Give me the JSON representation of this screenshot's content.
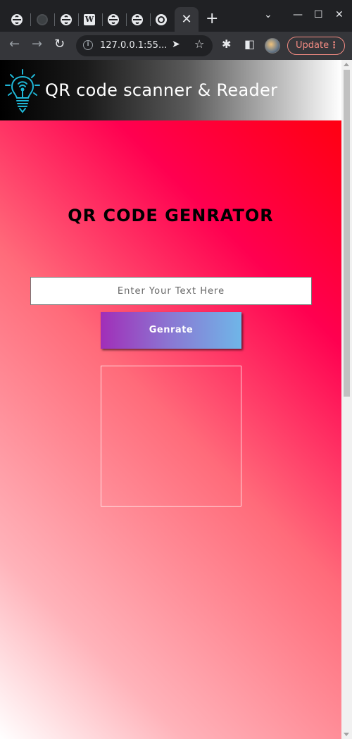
{
  "browser": {
    "tabs": [
      {
        "icon": "globe-icon"
      },
      {
        "icon": "github-icon"
      },
      {
        "icon": "globe-icon"
      },
      {
        "icon": "wikipedia-icon",
        "glyph": "W"
      },
      {
        "icon": "globe-icon"
      },
      {
        "icon": "globe-icon"
      },
      {
        "icon": "chrome-icon"
      },
      {
        "icon": "close-icon",
        "active": true
      }
    ],
    "new_tab_glyph": "+",
    "address": "127.0.0.1:55...",
    "update_label": "Update"
  },
  "header": {
    "title": "QR code scanner & Reader",
    "logo_icon": "lightbulb-icon",
    "logo_color": "#1fb6d6"
  },
  "main": {
    "heading": "QR CODE GENRATOR",
    "input_placeholder": "Enter Your Text Here",
    "input_value": "",
    "button_label": "Genrate"
  },
  "colors": {
    "gradient_top": "#ff0000",
    "gradient_mid": "#ff0050",
    "gradient_bottom": "#ffffff",
    "button_start": "#a12eb8",
    "button_end": "#6fb6e8"
  }
}
